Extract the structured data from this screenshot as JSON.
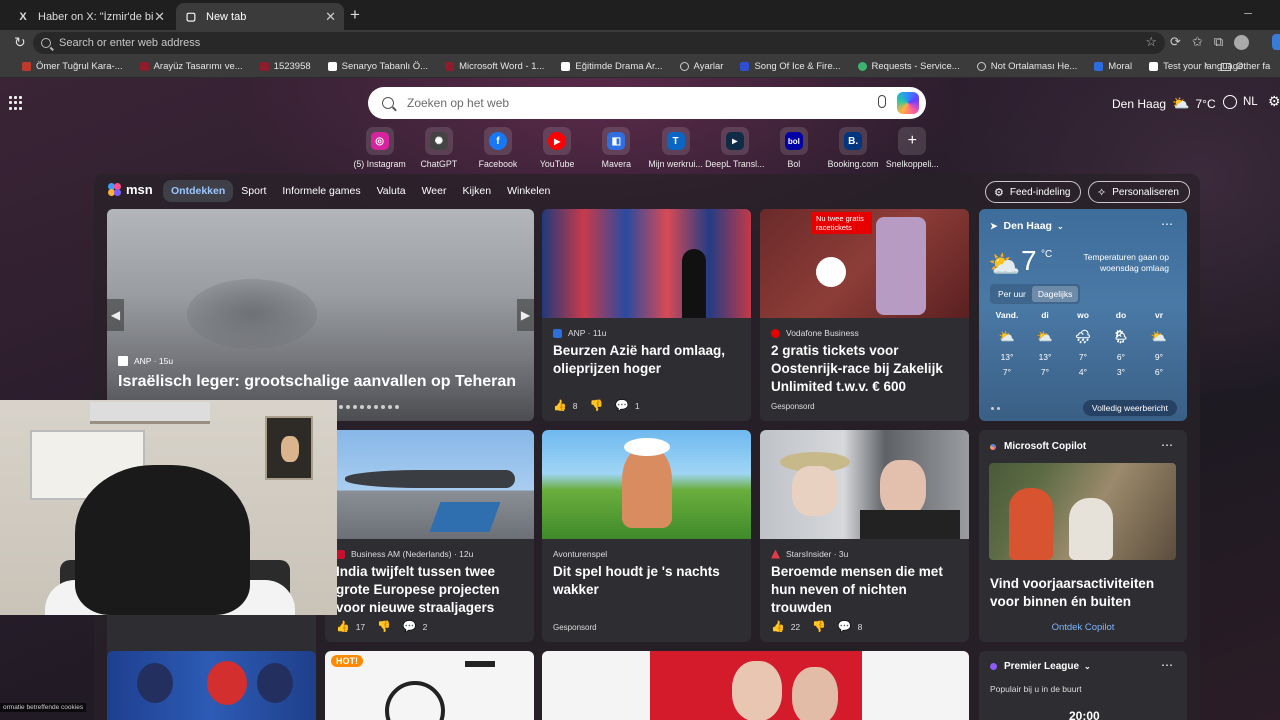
{
  "tabs": [
    {
      "title": "Haber on X: \"İzmir'de bisikletliyi sü",
      "icon": "X",
      "close": "✕"
    },
    {
      "title": "New tab",
      "icon": "▢",
      "close": "✕"
    }
  ],
  "omnibox": {
    "placeholder": "Search or enter web address"
  },
  "bookmarks": [
    {
      "label": "Ömer Tuğrul Kara-...",
      "color": "#c0392b"
    },
    {
      "label": "Arayüz Tasarımı ve...",
      "color": "#8e1d2c"
    },
    {
      "label": "1523958",
      "color": "#8e1d2c"
    },
    {
      "label": "Senaryo Tabanlı Ö...",
      "color": "#ffffff"
    },
    {
      "label": "Microsoft Word - 1...",
      "color": "#8e1d2c"
    },
    {
      "label": "Eğitimde Drama Ar...",
      "color": "#ffffff"
    },
    {
      "label": "Ayarlar",
      "color": "#cccccc"
    },
    {
      "label": "Song Of Ice & Fire...",
      "color": "#2d4fd0"
    },
    {
      "label": "Requests - Service...",
      "color": "#3cb371"
    },
    {
      "label": "Not Ortalaması He...",
      "color": "#cccccc"
    },
    {
      "label": "Moral",
      "color": "#2d6be0"
    },
    {
      "label": "Test your language...",
      "color": "#ffffff"
    }
  ],
  "bookmarks_other": "Other fa",
  "search": {
    "placeholder": "Zoeken op het web"
  },
  "header_weather": {
    "city": "Den Haag",
    "temp": "7°C"
  },
  "language": "NL",
  "shortcuts": [
    {
      "label": "(5) Instagram",
      "glyph": "◎",
      "color": "#d6249f"
    },
    {
      "label": "ChatGPT",
      "glyph": "✺",
      "color": "#444444"
    },
    {
      "label": "Facebook",
      "glyph": "f",
      "color": "#1877f2"
    },
    {
      "label": "YouTube",
      "glyph": "▶",
      "color": "#ff0000"
    },
    {
      "label": "Mavera",
      "glyph": "◧",
      "color": "#2f6fe0"
    },
    {
      "label": "Mijn werkrui...",
      "glyph": "T",
      "color": "#0a66c2"
    },
    {
      "label": "DeepL Transl...",
      "glyph": "▸",
      "color": "#0f2b46"
    },
    {
      "label": "Bol",
      "glyph": "bol",
      "color": "#0000a4"
    },
    {
      "label": "Booking.com",
      "glyph": "B.",
      "color": "#003580"
    },
    {
      "label": "Snelkoppeli...",
      "glyph": "+",
      "color": "#555555"
    }
  ],
  "msn": {
    "logo": "msn",
    "nav": [
      "Ontdekken",
      "Sport",
      "Informele games",
      "Valuta",
      "Weer",
      "Kijken",
      "Winkelen"
    ],
    "feed_layout_btn": "Feed-indeling",
    "personalize_btn": "Personaliseren"
  },
  "hero": {
    "source": "ANP · 15u",
    "headline": "Israëlisch leger: grootschalige aanvallen op Teheran"
  },
  "cards": [
    {
      "source": "ANP · 11u",
      "headline": "Beurzen Azië hard omlaag, olieprijzen hoger",
      "likes": "8",
      "comments": "1"
    },
    {
      "source": "Vodafone Business",
      "headline": "2 gratis tickets voor Oostenrijk-race bij Zakelijk Unlimited t.w.v. € 600",
      "sponsored": "Gesponsord",
      "ad_tag": "Nu twee gratis racetickets"
    },
    {
      "source": "Business AM (Nederlands) · 12u",
      "headline": "India twijfelt tussen twee grote Europese projecten voor nieuwe straaljagers",
      "likes": "17",
      "comments": "2"
    },
    {
      "source": "Avonturenspel",
      "headline": "Dit spel houdt je 's nachts wakker",
      "sponsored": "Gesponsord"
    },
    {
      "source": "StarsInsider · 3u",
      "headline": "Beroemde mensen die met hun neven of nichten trouwden",
      "likes": "22",
      "comments": "8"
    }
  ],
  "weather_card": {
    "city": "Den Haag",
    "temp": "7",
    "unit": "°C",
    "note": "Temperaturen gaan op woensdag omlaag",
    "toggle": [
      "Per uur",
      "Dagelijks"
    ],
    "days": [
      {
        "d": "Vand.",
        "hi": "13°",
        "lo": "7°",
        "icon": "⛅"
      },
      {
        "d": "di",
        "hi": "13°",
        "lo": "7°",
        "icon": "⛅"
      },
      {
        "d": "wo",
        "hi": "7°",
        "lo": "4°",
        "icon": "🌧"
      },
      {
        "d": "do",
        "hi": "6°",
        "lo": "3°",
        "icon": "🌦"
      },
      {
        "d": "vr",
        "hi": "9°",
        "lo": "6°",
        "icon": "⛅"
      }
    ],
    "full_btn": "Volledig weerbericht"
  },
  "copilot_card": {
    "title": "Microsoft Copilot",
    "headline": "Vind voorjaarsactiviteiten voor binnen én buiten",
    "link": "Ontdek Copilot"
  },
  "premier_card": {
    "title": "Premier League",
    "subtitle": "Populair bij u in de buurt",
    "score": "20:00"
  },
  "cookie_text": "ormatie betreffende cookies"
}
